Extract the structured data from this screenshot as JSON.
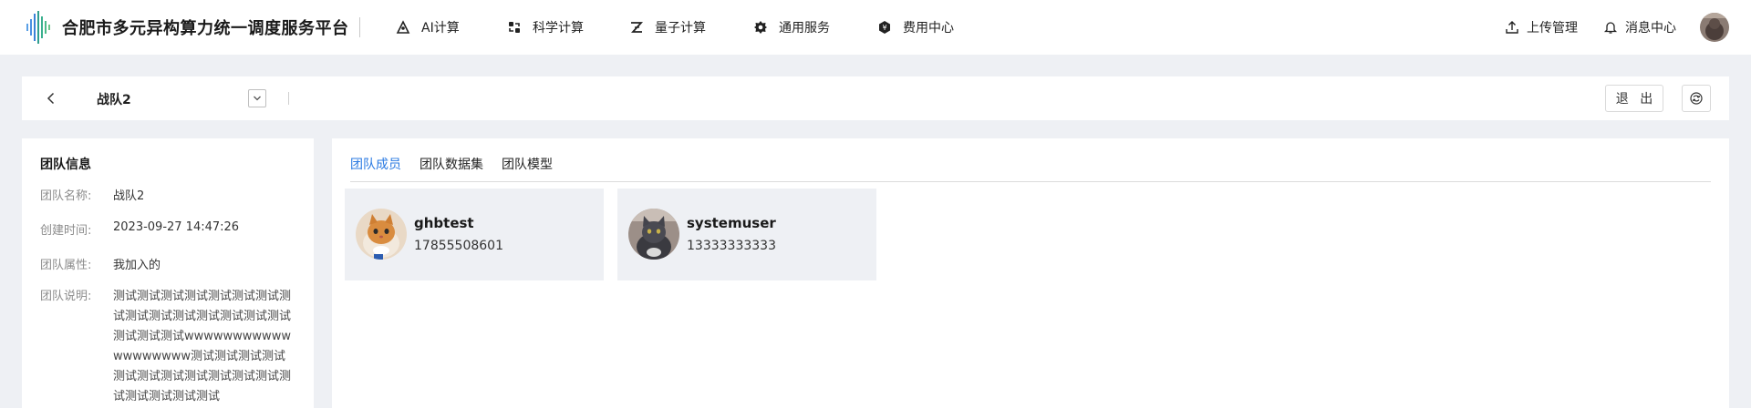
{
  "app": {
    "title": "合肥市多元异构算力统一调度服务平台"
  },
  "nav": {
    "items": [
      {
        "label": "AI计算",
        "icon": "ai-compute-icon"
      },
      {
        "label": "科学计算",
        "icon": "science-compute-icon"
      },
      {
        "label": "量子计算",
        "icon": "quantum-compute-icon"
      },
      {
        "label": "通用服务",
        "icon": "general-service-icon"
      },
      {
        "label": "费用中心",
        "icon": "billing-center-icon"
      }
    ],
    "right": {
      "upload_label": "上传管理",
      "message_label": "消息中心"
    }
  },
  "teambar": {
    "team_name": "战队2",
    "exit_label": "退 出"
  },
  "team_info": {
    "title": "团队信息",
    "rows": [
      {
        "label": "团队名称:",
        "value": "战队2"
      },
      {
        "label": "创建时间:",
        "value": "2023-09-27 14:47:26"
      },
      {
        "label": "团队属性:",
        "value": "我加入的"
      }
    ],
    "desc_label": "团队说明:",
    "desc_value": "测试测试测试测试测试测试测试测试测试测试测试测试测试测试测试测试测试测试wwwwwwwwwwwwwwwwwww测试测试测试测试测试测试测试测试测试测试测试测试测试测试测试测试"
  },
  "tabs": [
    {
      "label": "团队成员",
      "active": true
    },
    {
      "label": "团队数据集",
      "active": false
    },
    {
      "label": "团队模型",
      "active": false
    }
  ],
  "members": [
    {
      "name": "ghbtest",
      "phone": "17855508601",
      "avatar": "orange-cat-avatar"
    },
    {
      "name": "systemuser",
      "phone": "13333333333",
      "avatar": "gray-cat-avatar"
    }
  ],
  "colors": {
    "accent": "#2a7ae2",
    "page_bg": "#eef0f4",
    "card_bg": "#eef0f4"
  }
}
